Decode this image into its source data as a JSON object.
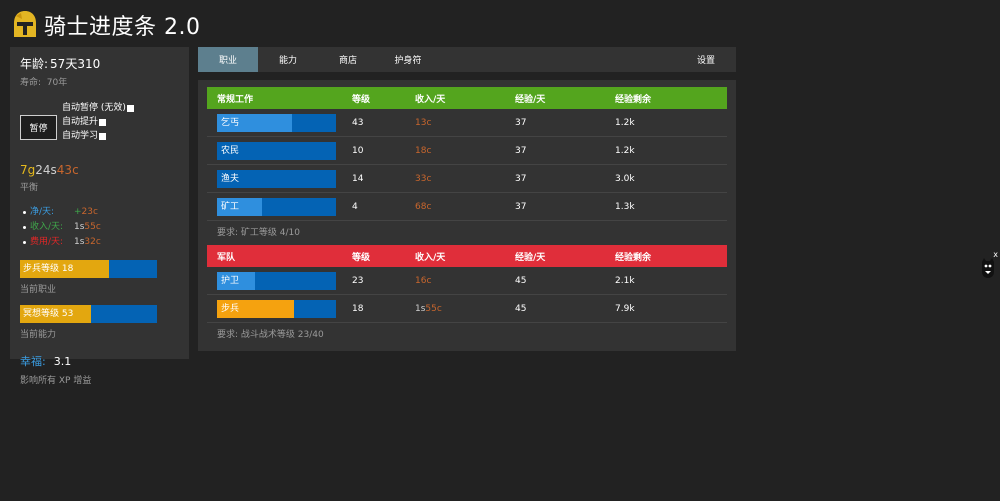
{
  "app": {
    "title": "骑士进度条 2.0"
  },
  "sidebar": {
    "age_label": "年龄:",
    "age_value": "57天310",
    "lifespan_label": "寿命:",
    "lifespan_value": "70年",
    "pause_label": "暂停",
    "auto_options": [
      {
        "label": "自动暂停 (无效)"
      },
      {
        "label": "自动提升"
      },
      {
        "label": "自动学习"
      }
    ],
    "coins": {
      "gold": "7g",
      "silver": "24s",
      "copper": "43c"
    },
    "balance_label": "平衡",
    "stats": [
      {
        "label": "净/天:",
        "value_prefix": "+",
        "value_main": "",
        "value_copper": "23c"
      },
      {
        "label": "收入/天:",
        "value_prefix": "",
        "value_main": "1s",
        "value_copper": "55c"
      },
      {
        "label": "费用/天:",
        "value_prefix": "",
        "value_main": "1s",
        "value_copper": "32c"
      }
    ],
    "current_job": {
      "label": "步兵等级 18",
      "progress": 0.65,
      "caption": "当前职业"
    },
    "current_skill": {
      "label": "冥想等级 53",
      "progress": 0.52,
      "caption": "当前能力"
    },
    "happiness": {
      "label": "幸福:",
      "value": "3.1",
      "desc": "影响所有 XP 增益"
    }
  },
  "tabs": [
    {
      "label": "职业",
      "active": true
    },
    {
      "label": "能力",
      "active": false
    },
    {
      "label": "商店",
      "active": false
    },
    {
      "label": "护身符",
      "active": false
    },
    {
      "label": "设置",
      "active": false
    }
  ],
  "columns": {
    "level": "等级",
    "income": "收入/天",
    "xp": "经验/天",
    "xp_left": "经验剩余"
  },
  "categories": [
    {
      "name": "常规工作",
      "color": "#54a51e",
      "jobs": [
        {
          "name": "乞丐",
          "level": "43",
          "income": "13c",
          "xp": "37",
          "xp_left": "1.2k",
          "progress": 0.63,
          "fill": "#2f8fde"
        },
        {
          "name": "农民",
          "level": "10",
          "income": "18c",
          "xp": "37",
          "xp_left": "1.2k",
          "progress": 0.0,
          "fill": "#2f8fde"
        },
        {
          "name": "渔夫",
          "level": "14",
          "income": "33c",
          "xp": "37",
          "xp_left": "3.0k",
          "progress": 0.0,
          "fill": "#2f8fde"
        },
        {
          "name": "矿工",
          "level": "4",
          "income": "68c",
          "xp": "37",
          "xp_left": "1.3k",
          "progress": 0.38,
          "fill": "#2f8fde"
        }
      ],
      "requirement": "要求: 矿工等级 4/10"
    },
    {
      "name": "军队",
      "color": "#e02e3a",
      "jobs": [
        {
          "name": "护卫",
          "level": "23",
          "income": "16c",
          "xp": "45",
          "xp_left": "2.1k",
          "progress": 0.32,
          "fill": "#2f8fde"
        },
        {
          "name": "步兵",
          "level": "18",
          "income": "",
          "income_silver": "1s",
          "income_copper": "55c",
          "xp": "45",
          "xp_left": "7.9k",
          "progress": 0.65,
          "fill": "#f5a20f"
        }
      ],
      "requirement": "要求: 战斗战术等级 23/40"
    }
  ],
  "float": {
    "close": "x"
  }
}
